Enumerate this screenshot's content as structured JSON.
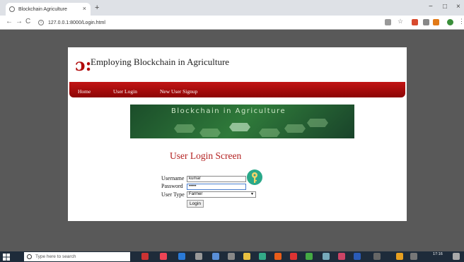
{
  "browser": {
    "tab_title": "Blockchain Agriculture",
    "new_tab_symbol": "+",
    "close_symbol": "×",
    "url": "127.0.0.1:8000/Login.html",
    "window_controls": {
      "minimize": "−",
      "maximize": "□",
      "close": "×"
    }
  },
  "site": {
    "logo_glyph": "ɔ:",
    "title": "Employing Blockchain in Agriculture",
    "nav": [
      "Home",
      "User Login",
      "New User Signup"
    ],
    "banner_text": "Blockchain in Agriculture"
  },
  "login": {
    "heading": "User Login Screen",
    "username_label": "Username",
    "username_value": "kumar",
    "password_label": "Password",
    "password_value": "•••••",
    "user_type_label": "User Type",
    "user_type_selected": "Farmer",
    "submit_label": "Login"
  },
  "taskbar": {
    "search_placeholder": "Type here to search",
    "time": "17:16"
  },
  "colors": {
    "accent_red": "#b10b0b",
    "nav_bg": "#a80d0d",
    "key_icon": "#2aa889"
  }
}
